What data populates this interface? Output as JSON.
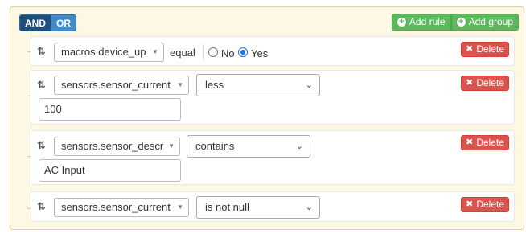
{
  "group": {
    "condition_and": "AND",
    "condition_or": "OR",
    "add_rule": "Add rule",
    "add_group": "Add group"
  },
  "rules": [
    {
      "field": "macros.device_up",
      "operator": "equal",
      "radio_no": "No",
      "radio_yes": "Yes",
      "selected": "Yes",
      "delete": "Delete"
    },
    {
      "field": "sensors.sensor_current",
      "operator": "less",
      "value": "100",
      "delete": "Delete"
    },
    {
      "field": "sensors.sensor_descr",
      "operator": "contains",
      "value": "AC Input",
      "delete": "Delete"
    },
    {
      "field": "sensors.sensor_current",
      "operator": "is not null",
      "delete": "Delete"
    }
  ],
  "icons": {
    "drag": "sort-arrows-icon",
    "add": "plus-circle-icon",
    "delete": "times-icon",
    "caret": "chevron-down-icon"
  },
  "colors": {
    "group_bg": "#fcf8e3",
    "and_active": "#1f4e7a",
    "or": "#428bca",
    "success": "#5cb85c",
    "danger": "#d9534f"
  }
}
